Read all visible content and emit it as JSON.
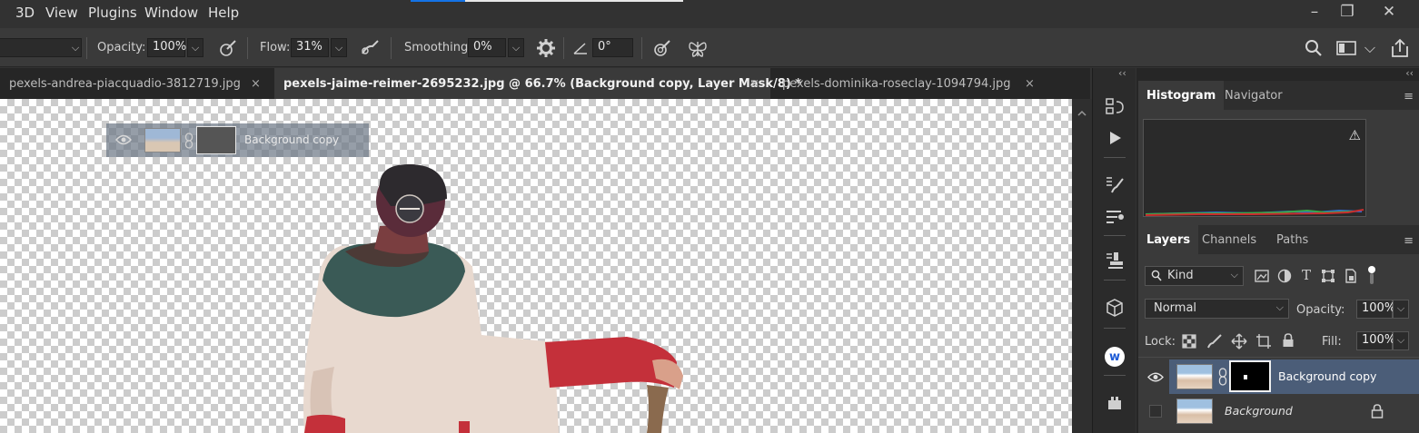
{
  "menu": {
    "items": [
      "3D",
      "View",
      "Plugins",
      "Window",
      "Help"
    ],
    "window_controls": {
      "minimize": "–",
      "restore": "❐",
      "close": "✕"
    }
  },
  "options": {
    "opacity_label": "Opacity:",
    "opacity_value": "100%",
    "flow_label": "Flow:",
    "flow_value": "31%",
    "smoothing_label": "Smoothing:",
    "smoothing_value": "0%",
    "angle_value": "0°",
    "dropdown_glyph": "⌵"
  },
  "tabs": [
    {
      "label": "pexels-andrea-piacquadio-3812719.jpg",
      "close": "×"
    },
    {
      "label": "pexels-jaime-reimer-2695232.jpg @ 66.7% (Background copy, Layer Mask/8) *",
      "close": "×"
    },
    {
      "label": "pexels-dominika-roseclay-1094794.jpg",
      "close": "×"
    }
  ],
  "drag_ghost": {
    "label": "Background copy"
  },
  "histogram_panel": {
    "tabs": [
      "Histogram",
      "Navigator"
    ],
    "menu_glyph": "≡",
    "warning_glyph": "⚠"
  },
  "layers_panel": {
    "tabs": [
      "Layers",
      "Channels",
      "Paths"
    ],
    "menu_glyph": "≡",
    "filter_kind": "Kind",
    "blend_mode": "Normal",
    "opacity_label": "Opacity:",
    "opacity_value": "100%",
    "lock_label": "Lock:",
    "fill_label": "Fill:",
    "fill_value": "100%",
    "layers": [
      {
        "name": "Background copy",
        "visible": true,
        "selected": true,
        "has_mask": true
      },
      {
        "name": "Background",
        "visible": false,
        "selected": false,
        "locked": true
      }
    ]
  },
  "toolstrip": {
    "collapse_glyph": "‹‹",
    "plugin_letter": "w"
  },
  "colors": {
    "accent": "#1473e6",
    "selected_layer": "#4b5d78",
    "canvas_checker": "#cccccc"
  }
}
